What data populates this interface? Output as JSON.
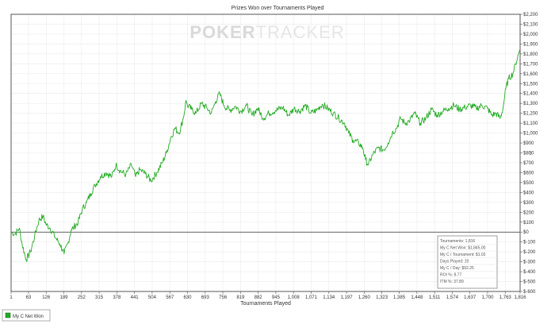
{
  "chart_data": {
    "type": "line",
    "title": "Prizes Won over Tournaments Played",
    "watermark": {
      "part1": "POKER",
      "part2": "TRACKER"
    },
    "xlabel": "Tournaments Played",
    "ylabel": "",
    "xlim": [
      1,
      1816
    ],
    "ylim": [
      -600,
      2200
    ],
    "x_ticks": [
      1,
      63,
      126,
      189,
      252,
      315,
      378,
      441,
      504,
      567,
      630,
      693,
      756,
      819,
      882,
      945,
      1008,
      1071,
      1134,
      1197,
      1260,
      1323,
      1385,
      1448,
      1511,
      1574,
      1637,
      1700,
      1763,
      1816
    ],
    "y_ticks": [
      -600,
      -500,
      -400,
      -300,
      -200,
      -100,
      0,
      100,
      200,
      300,
      400,
      500,
      600,
      700,
      800,
      900,
      1000,
      1100,
      1200,
      1300,
      1400,
      1500,
      1600,
      1700,
      1800,
      1900,
      2000,
      2100,
      2200
    ],
    "y_tick_labels": [
      "$-600",
      "$-500",
      "$-400",
      "$-300",
      "$-200",
      "$-100",
      "$0",
      "$100",
      "$200",
      "$300",
      "$400",
      "$500",
      "$600",
      "$700",
      "$800",
      "$900",
      "$1,000",
      "$1,100",
      "$1,200",
      "$1,300",
      "$1,400",
      "$1,500",
      "$1,600",
      "$1,700",
      "$1,800",
      "$1,900",
      "$2,000",
      "$2,100",
      "$2,200"
    ],
    "y_axis_side": "right",
    "grid": true,
    "zero_line": true,
    "series": [
      {
        "name": "My C Net Won",
        "color": "#22aa22",
        "x": [
          1,
          15,
          30,
          40,
          55,
          70,
          85,
          100,
          115,
          125,
          140,
          160,
          175,
          190,
          205,
          215,
          225,
          240,
          255,
          270,
          285,
          300,
          320,
          340,
          360,
          375,
          390,
          410,
          430,
          445,
          460,
          480,
          500,
          520,
          540,
          555,
          570,
          585,
          600,
          615,
          625,
          630,
          645,
          660,
          680,
          700,
          715,
          730,
          745,
          760,
          780,
          800,
          820,
          840,
          860,
          880,
          900,
          920,
          945,
          970,
          990,
          1010,
          1030,
          1050,
          1070,
          1090,
          1110,
          1130,
          1150,
          1170,
          1190,
          1205,
          1220,
          1240,
          1255,
          1265,
          1275,
          1290,
          1310,
          1330,
          1345,
          1360,
          1375,
          1390,
          1405,
          1420,
          1440,
          1460,
          1480,
          1500,
          1520,
          1540,
          1560,
          1580,
          1600,
          1620,
          1640,
          1660,
          1680,
          1700,
          1715,
          1730,
          1745,
          1755,
          1765,
          1775,
          1790,
          1800,
          1810,
          1816
        ],
        "y": [
          0,
          -20,
          40,
          -120,
          -280,
          -200,
          -40,
          120,
          160,
          80,
          40,
          -60,
          -120,
          -220,
          -100,
          20,
          50,
          100,
          230,
          300,
          390,
          470,
          560,
          600,
          560,
          680,
          620,
          580,
          680,
          560,
          630,
          590,
          520,
          600,
          700,
          800,
          950,
          1050,
          1000,
          1150,
          1330,
          1280,
          1240,
          1200,
          1300,
          1250,
          1200,
          1320,
          1400,
          1280,
          1230,
          1270,
          1220,
          1280,
          1180,
          1250,
          1150,
          1200,
          1230,
          1260,
          1180,
          1250,
          1220,
          1280,
          1200,
          1230,
          1290,
          1250,
          1200,
          1150,
          1100,
          1000,
          930,
          900,
          850,
          730,
          680,
          780,
          850,
          830,
          900,
          1000,
          1050,
          1150,
          1100,
          1120,
          1200,
          1100,
          1150,
          1240,
          1180,
          1220,
          1250,
          1280,
          1240,
          1260,
          1280,
          1250,
          1280,
          1250,
          1180,
          1200,
          1150,
          1250,
          1450,
          1550,
          1600,
          1700,
          1800,
          1845
        ]
      }
    ],
    "legend": {
      "position": "bottom-left",
      "entries": [
        "My C Net Won"
      ]
    },
    "stats_box": {
      "position": "bottom-right",
      "lines": [
        "Tournaments: 1,816",
        "My C Net Won: $1,845.00",
        "My C / Tournament: $1.02",
        "Days Played: 20",
        "My C / Day: $92.25",
        "ROI %: 8.77",
        "ITM %: 37.89"
      ]
    }
  }
}
